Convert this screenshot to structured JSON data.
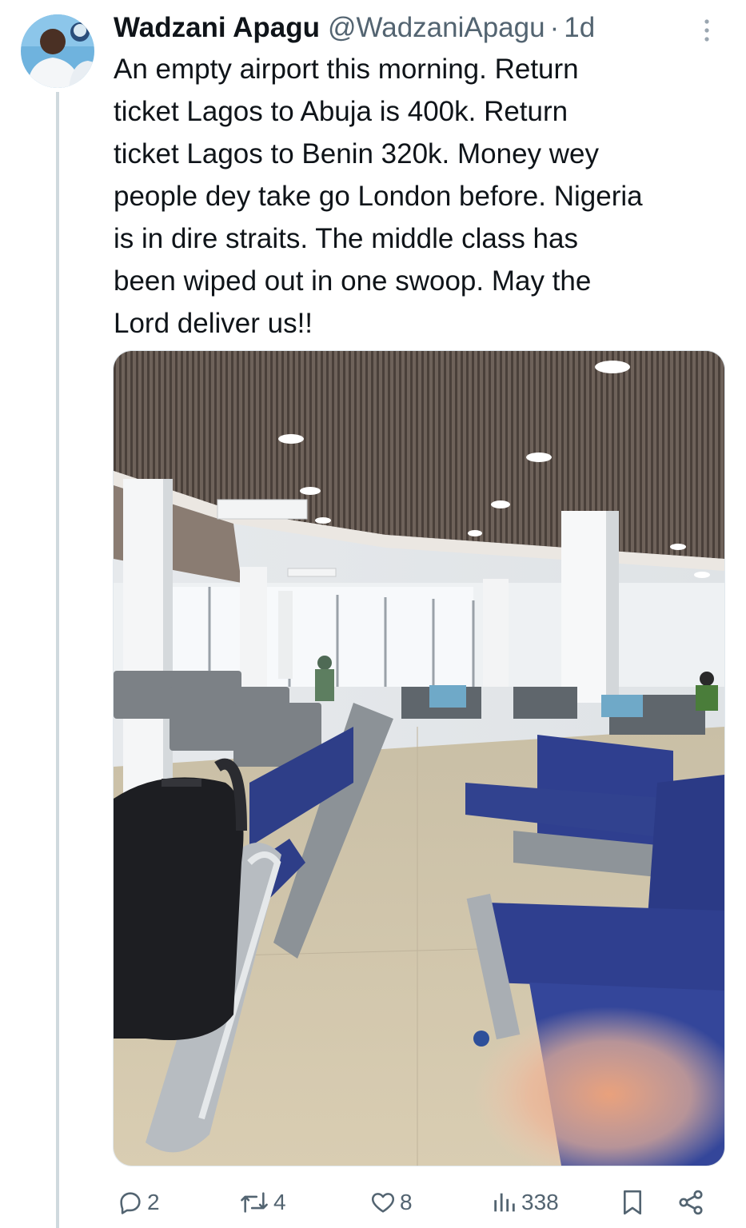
{
  "tweet": {
    "author_name": "Wadzani Apagu",
    "author_handle": "@WadzaniApagu",
    "separator": "·",
    "time_ago": "1d",
    "text_lines": [
      "An empty airport this morning. Return",
      "ticket Lagos to Abuja is 400k.  Return",
      "ticket Lagos to Benin 320k. Money wey",
      "people dey take go London before. Nigeria",
      "is in dire straits. The middle class has",
      "been wiped out in one swoop.  May the",
      "Lord deliver us!!"
    ]
  },
  "actions": {
    "replies": "2",
    "reposts": "4",
    "likes": "8",
    "views": "338"
  },
  "icons": {
    "avatar": "avatar-photo",
    "more": "more-vertical-icon",
    "reply": "reply-icon",
    "repost": "repost-icon",
    "like": "heart-icon",
    "views": "views-icon",
    "bookmark": "bookmark-icon",
    "share": "share-icon"
  },
  "colors": {
    "text": "#0f1419",
    "secondary": "#536471",
    "thread_line": "#cfd9de",
    "seat_blue": "#2f3f8f"
  }
}
